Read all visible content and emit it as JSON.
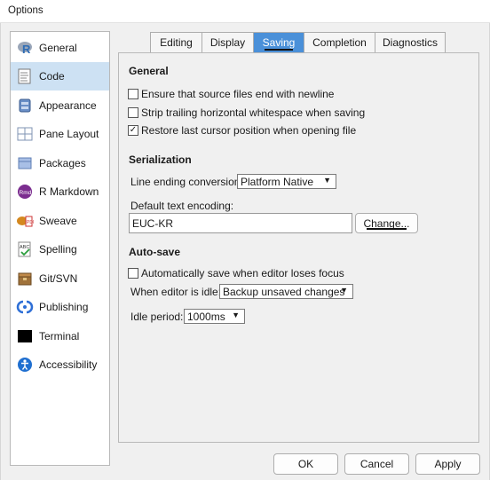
{
  "window": {
    "title": "Options"
  },
  "sidebar": {
    "items": [
      {
        "label": "General",
        "icon": "r-logo-icon"
      },
      {
        "label": "Code",
        "icon": "code-document-icon"
      },
      {
        "label": "Appearance",
        "icon": "paint-bucket-icon"
      },
      {
        "label": "Pane Layout",
        "icon": "pane-layout-icon"
      },
      {
        "label": "Packages",
        "icon": "packages-icon"
      },
      {
        "label": "R Markdown",
        "icon": "rmarkdown-icon"
      },
      {
        "label": "Sweave",
        "icon": "sweave-icon"
      },
      {
        "label": "Spelling",
        "icon": "spelling-icon"
      },
      {
        "label": "Git/SVN",
        "icon": "git-svn-icon"
      },
      {
        "label": "Publishing",
        "icon": "publishing-icon"
      },
      {
        "label": "Terminal",
        "icon": "terminal-icon"
      },
      {
        "label": "Accessibility",
        "icon": "accessibility-icon"
      }
    ],
    "selected": "Code"
  },
  "tabs": [
    {
      "label": "Editing"
    },
    {
      "label": "Display"
    },
    {
      "label": "Saving"
    },
    {
      "label": "Completion"
    },
    {
      "label": "Diagnostics"
    }
  ],
  "active_tab": "Saving",
  "general": {
    "heading": "General",
    "options": [
      {
        "label": "Ensure that source files end with newline",
        "checked": false
      },
      {
        "label": "Strip trailing horizontal whitespace when saving",
        "checked": false
      },
      {
        "label": "Restore last cursor position when opening file",
        "checked": true
      }
    ]
  },
  "serialization": {
    "heading": "Serialization",
    "line_ending_label": "Line ending conversion:",
    "line_ending_value": "Platform Native",
    "encoding_label": "Default text encoding:",
    "encoding_value": "EUC-KR",
    "change_button": "Change..."
  },
  "autosave": {
    "heading": "Auto-save",
    "focus_label": "Automatically save when editor loses focus",
    "focus_checked": false,
    "idle_label": "When editor is idle:",
    "idle_value": "Backup unsaved changes",
    "period_label": "Idle period:",
    "period_value": "1000ms"
  },
  "footer": {
    "ok": "OK",
    "cancel": "Cancel",
    "apply": "Apply"
  },
  "colors": {
    "accent": "#4a90d9",
    "selection": "#cde1f3"
  }
}
